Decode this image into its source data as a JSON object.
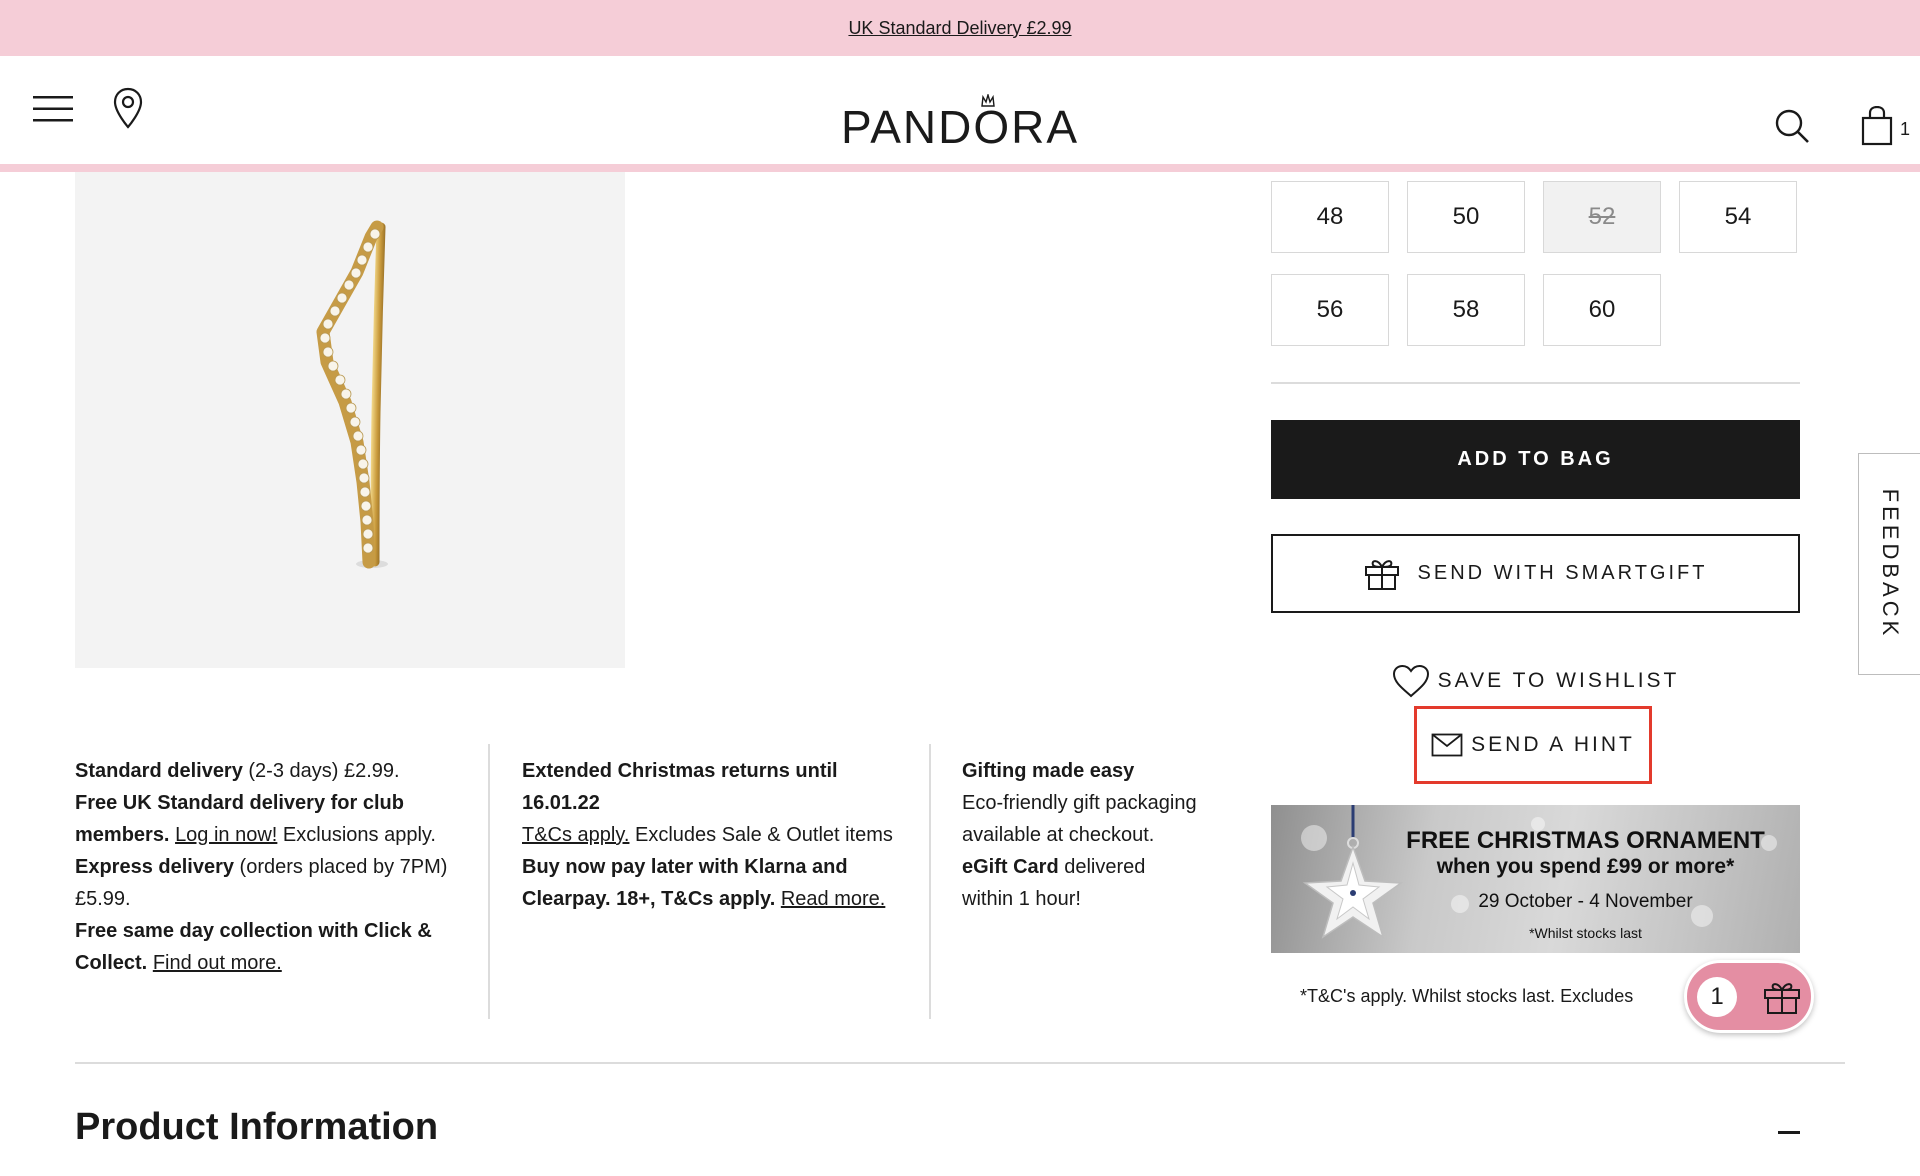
{
  "promo": {
    "text": "UK Standard Delivery £2.99"
  },
  "header": {
    "logo": "PANDORA",
    "bag_count": "1"
  },
  "sizes": {
    "options": [
      {
        "label": "48",
        "available": true
      },
      {
        "label": "50",
        "available": true
      },
      {
        "label": "52",
        "available": false
      },
      {
        "label": "54",
        "available": true
      },
      {
        "label": "56",
        "available": true
      },
      {
        "label": "58",
        "available": true
      },
      {
        "label": "60",
        "available": true
      }
    ]
  },
  "actions": {
    "add_to_bag": "ADD TO BAG",
    "smartgift": "SEND WITH SMARTGIFT",
    "wishlist": "SAVE TO WISHLIST",
    "hint": "SEND A HINT"
  },
  "banner": {
    "title": "FREE CHRISTMAS ORNAMENT",
    "subtitle": "when you spend £99 or more*",
    "dates": "29 October - 4 November",
    "note": "*Whilst stocks last"
  },
  "terms": "*T&C's apply. Whilst stocks last. Excludes",
  "gift_fab": {
    "count": "1"
  },
  "feedback": "FEEDBACK",
  "info": {
    "delivery": {
      "standard_bold": "Standard delivery",
      "standard_rest": " (2-3 days) £2.99.",
      "free_bold": "Free UK Standard delivery for club members.",
      "login_link": "Log in now!",
      "exclusions": " Exclusions apply.",
      "express_bold": "Express delivery",
      "express_rest": " (orders placed by 7PM) £5.99.",
      "collect_bold": "Free same day collection with Click & Collect.",
      "find_link": "Find out more."
    },
    "returns": {
      "title": "Extended Christmas returns until 16.01.22",
      "tcs_link": "T&Cs apply.",
      "tcs_rest": " Excludes Sale & Outlet items",
      "klarna_bold": "Buy now pay later with Klarna and Clearpay. 18+, T&Cs apply.",
      "read_link": "Read more."
    },
    "gifting": {
      "title": "Gifting made easy",
      "eco": "Eco-friendly gift packaging available at checkout.",
      "egift_bold": "eGift Card",
      "egift_rest": " delivered within 1 hour!"
    }
  },
  "product_info": {
    "heading": "Product Information"
  }
}
